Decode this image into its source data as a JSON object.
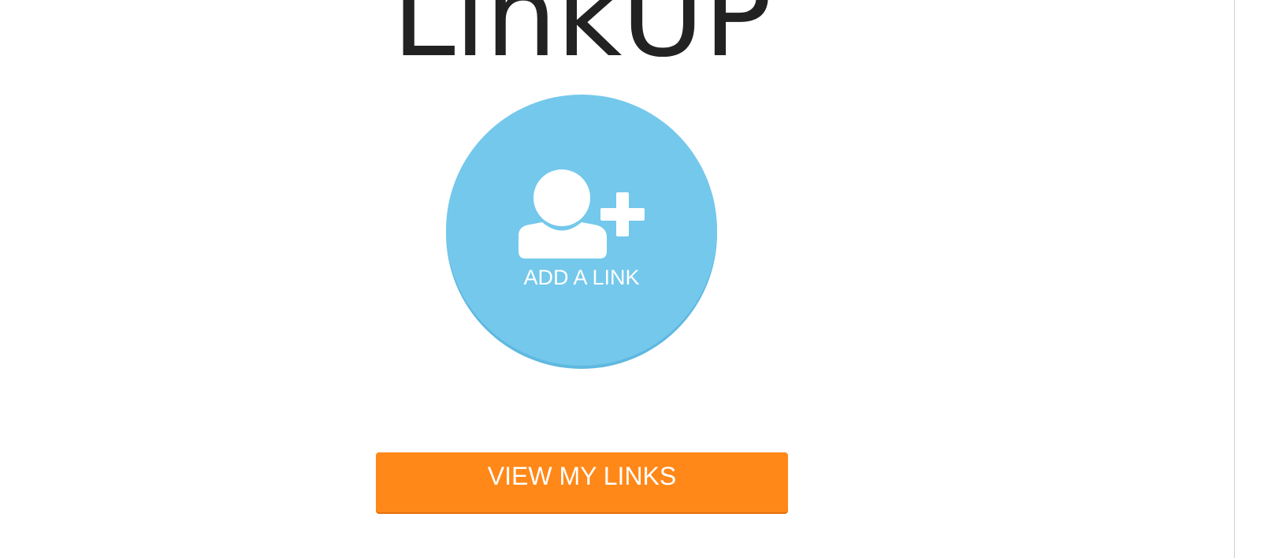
{
  "header": {
    "title": "LinkUP"
  },
  "main": {
    "add_link": {
      "label": "ADD A LINK",
      "icon": "add-user-icon",
      "color": "#74c8eb"
    },
    "view_links": {
      "label": "VIEW MY LINKS",
      "color": "#ff8818"
    }
  }
}
